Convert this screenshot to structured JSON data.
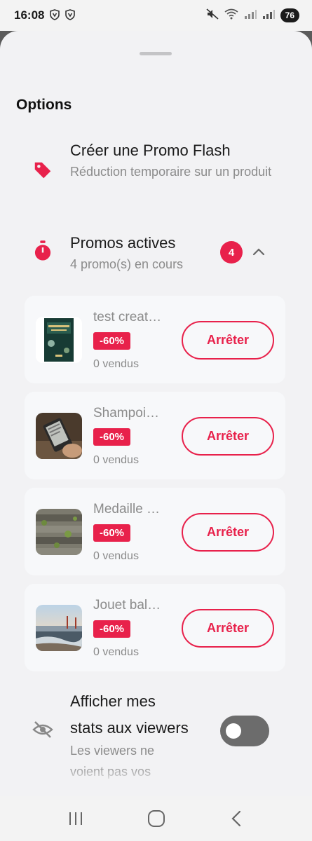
{
  "status": {
    "time": "16:08",
    "battery": "76",
    "icons": [
      "shield-icon",
      "shield-icon",
      "mute-icon",
      "wifi-icon",
      "signal-icon",
      "signal-icon"
    ]
  },
  "sheet": {
    "title": "Options",
    "promo_flash": {
      "icon": "tag-icon",
      "title": "Créer une Promo Flash",
      "subtitle": "Réduction temporaire sur un produit"
    },
    "active_promos": {
      "icon": "stopwatch-icon",
      "title": "Promos actives",
      "subtitle": "4 promo(s) en cours",
      "count": "4",
      "items": [
        {
          "name": "test creat…",
          "discount": "-60%",
          "sold": "0 vendus",
          "button": "Arrêter",
          "thumb": "book-cover"
        },
        {
          "name": "Shampoi…",
          "discount": "-60%",
          "sold": "0 vendus",
          "button": "Arrêter",
          "thumb": "ereader"
        },
        {
          "name": "Medaille …",
          "discount": "-60%",
          "sold": "0 vendus",
          "button": "Arrêter",
          "thumb": "wood-moss"
        },
        {
          "name": "Jouet bal…",
          "discount": "-60%",
          "sold": "0 vendus",
          "button": "Arrêter",
          "thumb": "beach-bridge"
        }
      ]
    },
    "stats": {
      "icon": "eye-off-icon",
      "title_line1": "Afficher mes",
      "title_line2": "stats aux viewers",
      "subtitle_line1": "Les viewers ne",
      "subtitle_line2": "voient pas vos",
      "toggle_on": false
    }
  },
  "colors": {
    "accent": "#e8214b",
    "muted": "#8b8b8b",
    "sheet_bg": "#f2f2f4"
  }
}
